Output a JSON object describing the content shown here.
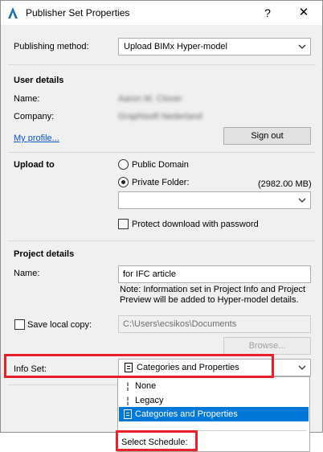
{
  "window": {
    "title": "Publisher Set Properties",
    "help_glyph": "?",
    "close_glyph": "✕"
  },
  "publishing": {
    "label": "Publishing method:",
    "value": "Upload BIMx Hyper-model"
  },
  "user_details": {
    "heading": "User details",
    "name_label": "Name:",
    "name_value": "Aaron M. Clover",
    "company_label": "Company:",
    "company_value": "Graphisoft Nederland",
    "profile_link": "My profile...",
    "sign_out": "Sign out"
  },
  "upload": {
    "heading": "Upload to",
    "public_label": "Public Domain",
    "private_label": "Private Folder:",
    "private_selected": true,
    "space": "(2982.00 MB)",
    "folder_value": "",
    "protect_label": "Protect download with password",
    "protect_checked": false
  },
  "project": {
    "heading": "Project details",
    "name_label": "Name:",
    "name_value": "for IFC article",
    "note": "Note: Information set in Project Info and Project Preview will be added to Hyper-model details.",
    "save_local_label": "Save local copy:",
    "save_local_checked": false,
    "local_path": "C:\\Users\\ecsikos\\Documents",
    "browse": "Browse..."
  },
  "info_set": {
    "label": "Info Set:",
    "value": "Categories and Properties",
    "options": [
      {
        "icon": "info-bar-icon",
        "label": "None"
      },
      {
        "icon": "info-bar-icon",
        "label": "Legacy"
      },
      {
        "icon": "document-icon",
        "label": "Categories and Properties",
        "selected": true
      }
    ],
    "schedule_label": "Select Schedule:"
  },
  "colors": {
    "highlight": "#e8202a",
    "selection": "#0078d7",
    "link": "#0b55c4"
  }
}
